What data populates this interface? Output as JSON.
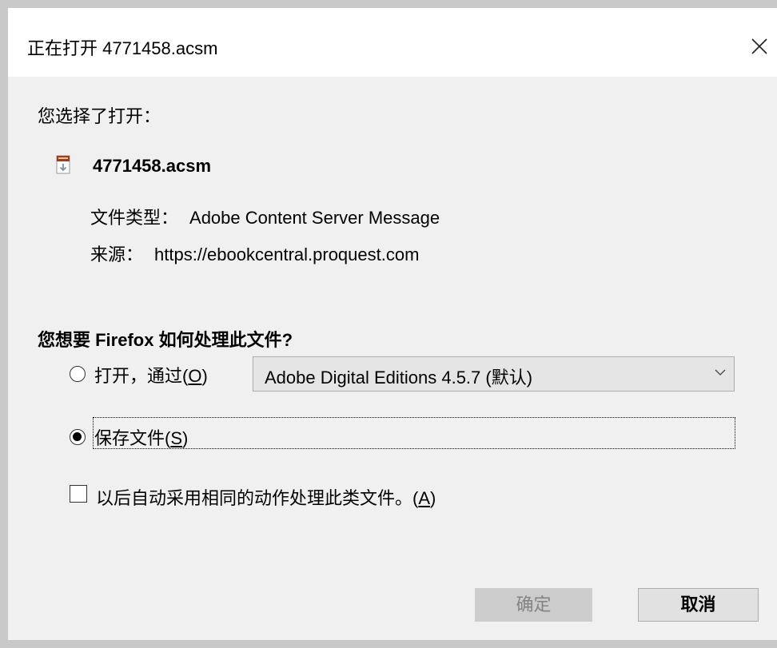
{
  "dialog": {
    "title": "正在打开 4771458.acsm",
    "close_symbol": "X"
  },
  "file": {
    "chosen_label": "您选择了打开：",
    "icon": "acsm-file-icon",
    "name": "4771458.acsm",
    "type_label": "文件类型：",
    "type_value": "Adobe Content Server Message",
    "source_label": "来源：",
    "source_value": "https://ebookcentral.proquest.com"
  },
  "handling": {
    "question": "您想要 Firefox 如何处理此文件?",
    "open_with_prefix": "打开，通过(",
    "open_with_key": "O",
    "open_with_suffix": ")",
    "open_with_app": "Adobe Digital Editions 4.5.7 (默认)",
    "save_prefix": "保存文件(",
    "save_key": "S",
    "save_suffix": ")",
    "selected_option": "save",
    "auto_prefix": "以后自动采用相同的动作处理此类文件。(",
    "auto_key": "A",
    "auto_suffix": ")",
    "auto_checked": false
  },
  "buttons": {
    "ok_label": "确定",
    "cancel_label": "取消"
  },
  "colors": {
    "titlebar": "#ffffff",
    "dialog_bg": "#f0f0f0",
    "button_disabled_bg": "#cccccc",
    "button_bg": "#e1e1e1"
  }
}
